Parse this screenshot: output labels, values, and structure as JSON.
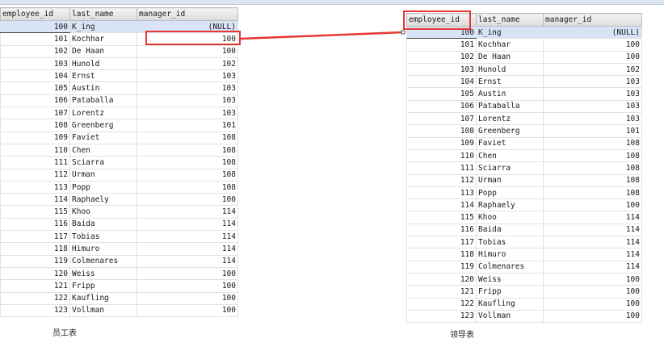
{
  "columns": [
    "employee_id",
    "last_name",
    "manager_id"
  ],
  "rows": [
    [
      "100",
      "K_ing",
      "(NULL)"
    ],
    [
      "101",
      "Kochhar",
      "100"
    ],
    [
      "102",
      "De Haan",
      "100"
    ],
    [
      "103",
      "Hunold",
      "102"
    ],
    [
      "104",
      "Ernst",
      "103"
    ],
    [
      "105",
      "Austin",
      "103"
    ],
    [
      "106",
      "Pataballa",
      "103"
    ],
    [
      "107",
      "Lorentz",
      "103"
    ],
    [
      "108",
      "Greenberg",
      "101"
    ],
    [
      "109",
      "Faviet",
      "108"
    ],
    [
      "110",
      "Chen",
      "108"
    ],
    [
      "111",
      "Sciarra",
      "108"
    ],
    [
      "112",
      "Urman",
      "108"
    ],
    [
      "113",
      "Popp",
      "108"
    ],
    [
      "114",
      "Raphaely",
      "100"
    ],
    [
      "115",
      "Khoo",
      "114"
    ],
    [
      "116",
      "Baida",
      "114"
    ],
    [
      "117",
      "Tobias",
      "114"
    ],
    [
      "118",
      "Himuro",
      "114"
    ],
    [
      "119",
      "Colmenares",
      "114"
    ],
    [
      "120",
      "Weiss",
      "100"
    ],
    [
      "121",
      "Fripp",
      "100"
    ],
    [
      "122",
      "Kaufling",
      "100"
    ],
    [
      "123",
      "Vollman",
      "100"
    ]
  ],
  "left_caption": "员工表",
  "right_caption": "领导表",
  "highlight_color": "#e53935"
}
